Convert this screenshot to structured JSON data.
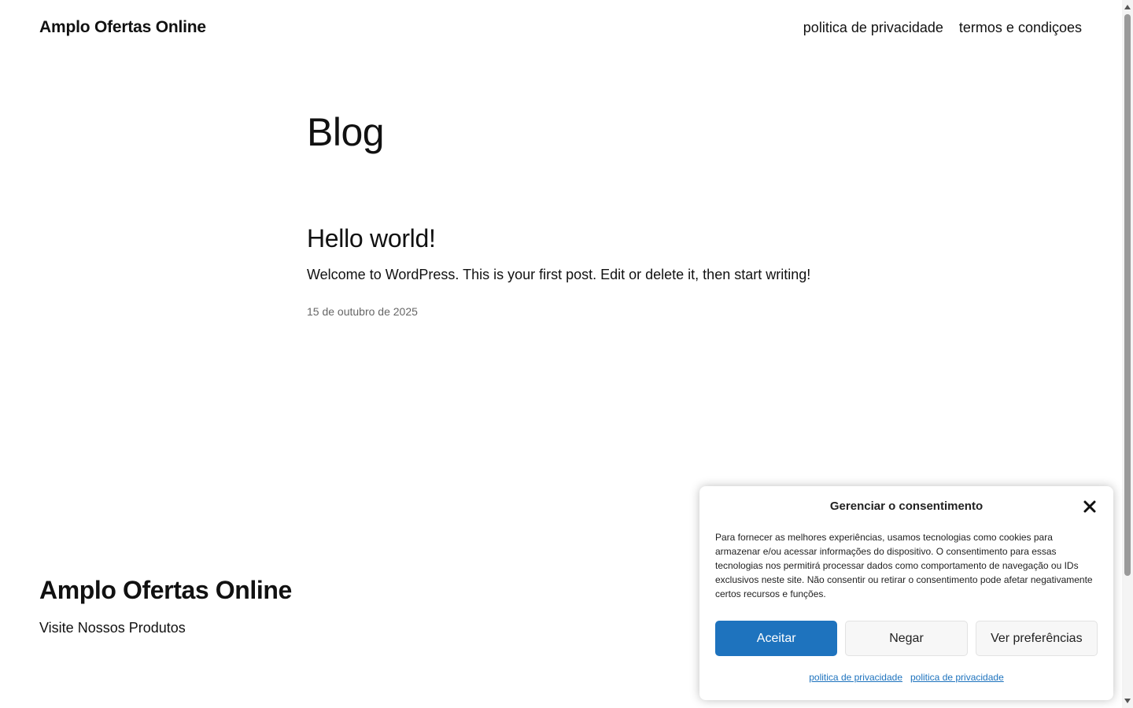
{
  "header": {
    "site_title": "Amplo Ofertas Online",
    "nav": [
      {
        "label": "politica de privacidade"
      },
      {
        "label": "termos e condiçoes"
      }
    ]
  },
  "main": {
    "page_title": "Blog",
    "post": {
      "title": "Hello world!",
      "excerpt": "Welcome to WordPress. This is your first post. Edit or delete it, then start writing!",
      "date": "15 de outubro de 2025"
    }
  },
  "footer": {
    "site_title": "Amplo Ofertas Online",
    "tagline": "Visite Nossos Produtos"
  },
  "consent": {
    "title": "Gerenciar o consentimento",
    "text": "Para fornecer as melhores experiências, usamos tecnologias como cookies para armazenar e/ou acessar informações do dispositivo. O consentimento para essas tecnologias nos permitirá processar dados como comportamento de navegação ou IDs exclusivos neste site. Não consentir ou retirar o consentimento pode afetar negativamente certos recursos e funções.",
    "buttons": {
      "accept": "Aceitar",
      "deny": "Negar",
      "preferences": "Ver preferências"
    },
    "links": [
      {
        "label": "politica de privacidade"
      },
      {
        "label": "politica de privacidade"
      }
    ],
    "accent_color": "#1e73be"
  },
  "icons": {
    "close": "close-icon",
    "scroll_up": "chevron-up-icon",
    "scroll_down": "chevron-down-icon"
  }
}
